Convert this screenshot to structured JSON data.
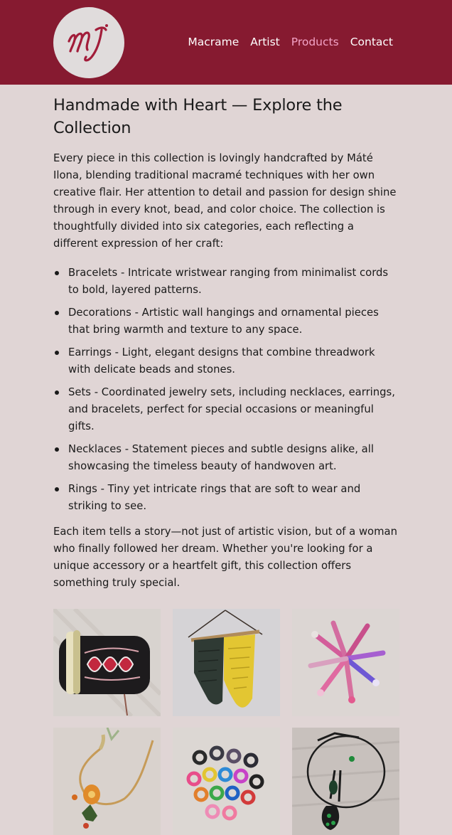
{
  "header": {
    "logo_alt": "MI",
    "nav": [
      {
        "label": "Macrame",
        "active": false
      },
      {
        "label": "Artist",
        "active": false
      },
      {
        "label": "Products",
        "active": true
      },
      {
        "label": "Contact",
        "active": false
      }
    ]
  },
  "main": {
    "title": "Handmade with Heart — Explore the Collection",
    "intro": "Every piece in this collection is lovingly handcrafted by Máté Ilona, blending traditional macramé techniques with her own creative flair. Her attention to detail and passion for design shine through in every knot, bead, and color choice. The collection is thoughtfully divided into six categories, each reflecting a different expression of her craft:",
    "categories": [
      "Bracelets - Intricate wristwear ranging from minimalist cords to bold, layered patterns.",
      "Decorations - Artistic wall hangings and ornamental pieces that bring warmth and texture to any space.",
      "Earrings - Light, elegant designs that combine threadwork with delicate beads and stones.",
      "Sets - Coordinated jewelry sets, including necklaces, earrings, and bracelets, perfect for special occasions or meaningful gifts.",
      "Necklaces - Statement pieces and subtle designs alike, all showcasing the timeless beauty of handwoven art.",
      "Rings - Tiny yet intricate rings that are soft to wear and striking to see."
    ],
    "outro": "Each item tells a story—not just of artistic vision, but of a woman who finally followed her dream. Whether you're looking for a unique accessory or a heartfelt gift, this collection offers something truly special."
  },
  "gallery": [
    {
      "subject": "bracelets"
    },
    {
      "subject": "decorations"
    },
    {
      "subject": "earrings"
    },
    {
      "subject": "sets"
    },
    {
      "subject": "rings"
    },
    {
      "subject": "necklaces"
    }
  ],
  "colors": {
    "header_bg": "#861a30",
    "page_bg": "#e0d5d5",
    "nav_active": "#f3a3c6",
    "logo_ink": "#a21d3a"
  }
}
